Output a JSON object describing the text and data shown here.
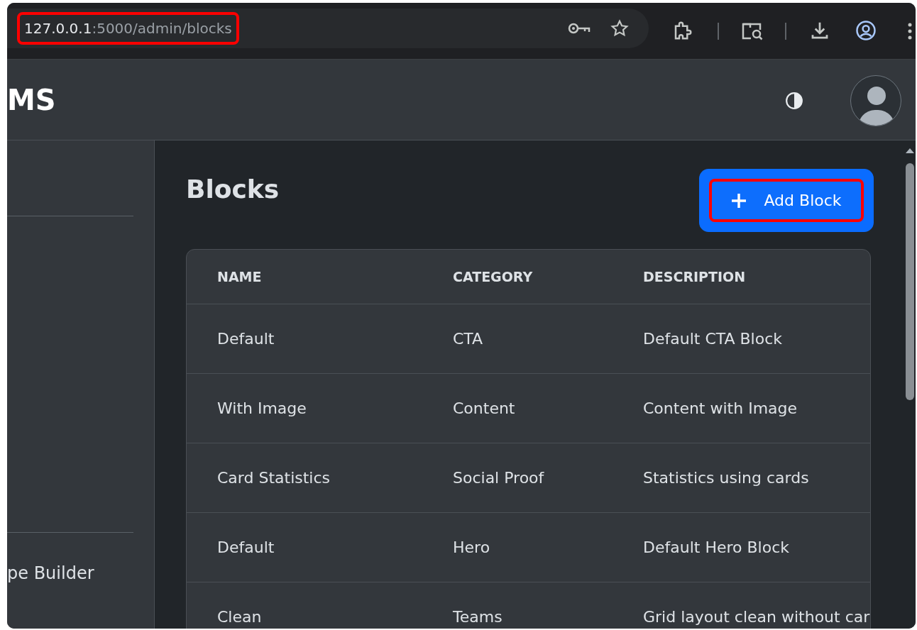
{
  "browser": {
    "address_host": "127.0.0.1",
    "address_path": ":5000/admin/blocks",
    "address_highlighted": true
  },
  "header": {
    "title": "MS"
  },
  "sidebar": {
    "items": [
      "pe Builder"
    ]
  },
  "page": {
    "title": "Blocks",
    "add_button": {
      "label": "Add Block",
      "focused": true,
      "highlighted": true
    }
  },
  "table": {
    "columns": [
      "NAME",
      "CATEGORY",
      "DESCRIPTION"
    ],
    "rows": [
      [
        "Default",
        "CTA",
        "Default CTA Block"
      ],
      [
        "With Image",
        "Content",
        "Content with Image"
      ],
      [
        "Card Statistics",
        "Social Proof",
        "Statistics using cards"
      ],
      [
        "Default",
        "Hero",
        "Default Hero Block"
      ],
      [
        "Clean",
        "Teams",
        "Grid layout clean without car"
      ]
    ]
  }
}
